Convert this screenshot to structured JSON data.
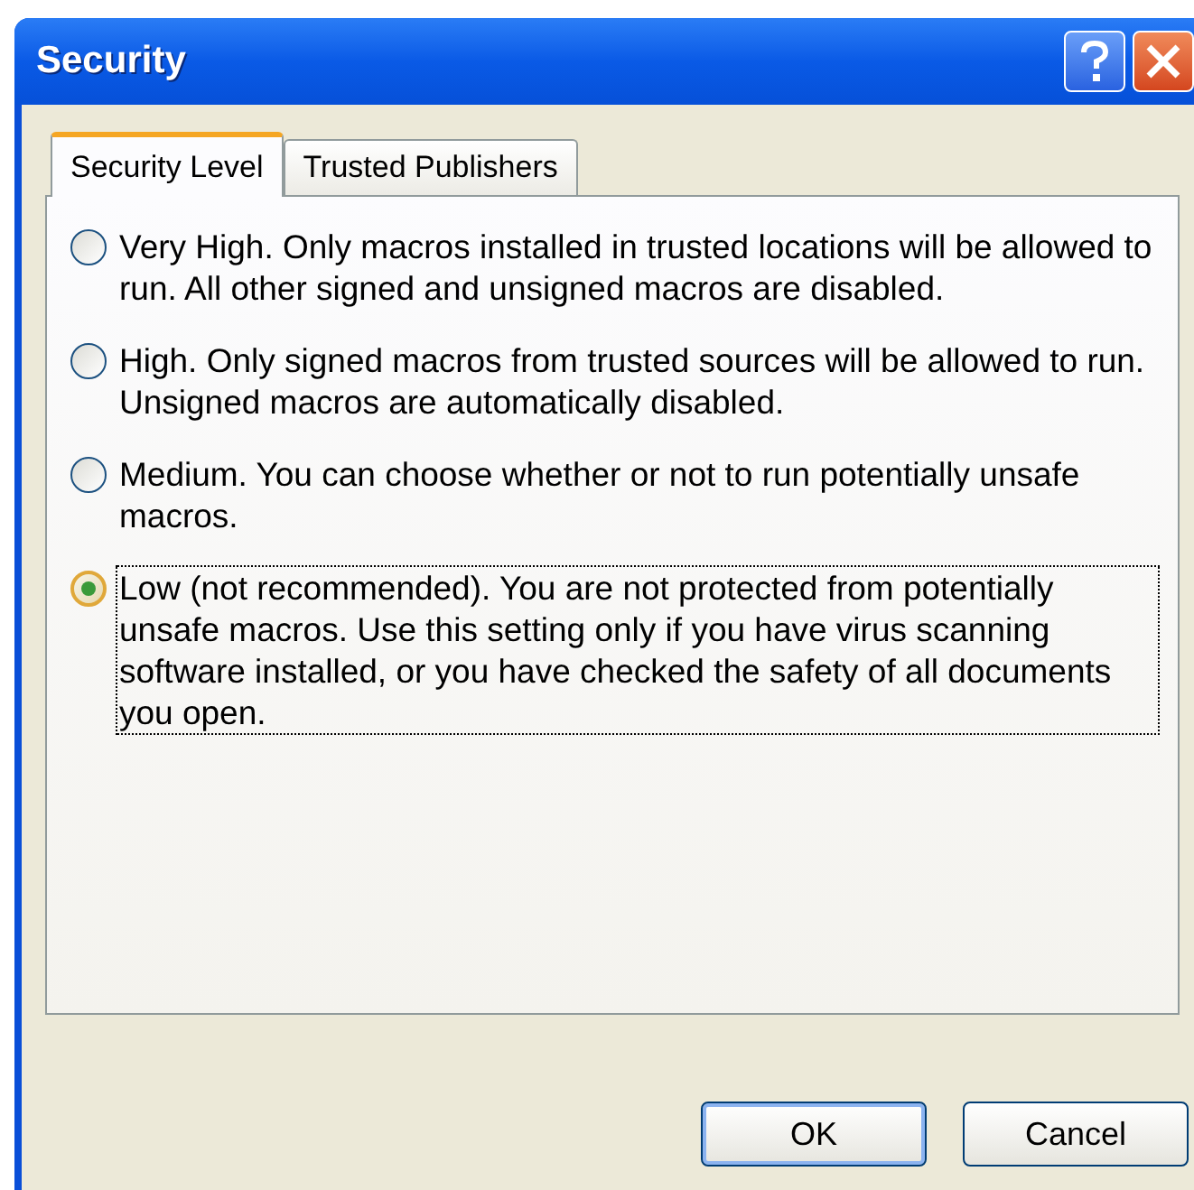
{
  "window": {
    "title": "Security"
  },
  "tabs": [
    {
      "label": "Security Level",
      "selected": true
    },
    {
      "label": "Trusted Publishers",
      "selected": false
    }
  ],
  "options": [
    {
      "text": "Very High. Only macros installed in trusted locations will be allowed to run. All other signed and unsigned macros are disabled.",
      "selected": false
    },
    {
      "text": "High. Only signed macros from trusted sources will be allowed to run. Unsigned macros are automatically disabled.",
      "selected": false
    },
    {
      "text": "Medium. You can choose whether or not to run potentially unsafe macros.",
      "selected": false
    },
    {
      "text": "Low (not recommended). You are not protected from potentially unsafe macros. Use this setting only if you have virus scanning software installed, or you have checked the safety of all documents you open.",
      "selected": true
    }
  ],
  "buttons": [
    {
      "label": "OK",
      "default": true
    },
    {
      "label": "Cancel",
      "default": false
    }
  ]
}
